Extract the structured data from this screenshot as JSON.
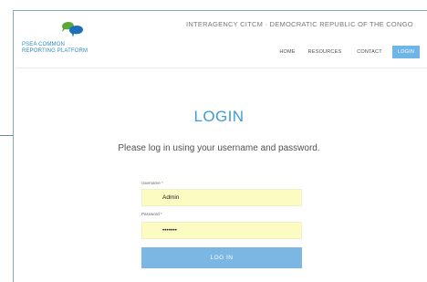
{
  "header": {
    "logo": {
      "line1": "PSEA COMMON",
      "line2": "REPORTING PLATFORM",
      "colors": {
        "green": "#5aa83b",
        "blue": "#1f6fb8"
      }
    },
    "title": "INTERAGENCY CITCM · DEMOCRATIC REPUBLIC OF THE CONGO"
  },
  "nav": {
    "items": [
      {
        "label": "HOME",
        "active": false
      },
      {
        "label": "RESOURCES",
        "active": false
      },
      {
        "label": "CONTACT",
        "active": false
      },
      {
        "label": "LOGIN",
        "active": true
      }
    ]
  },
  "main": {
    "heading": "LOGIN",
    "subtitle": "Please log in using your username and password."
  },
  "form": {
    "username_label": "Username",
    "username_value": "Admin",
    "password_label": "Password",
    "password_value": "•••••••",
    "required_marker": "*",
    "submit_label": "LOG IN"
  },
  "colors": {
    "accent": "#3e9cd8",
    "nav_active": "#6fb5e8",
    "input_bg": "#fbfbc2",
    "button": "#7cb6e2"
  }
}
